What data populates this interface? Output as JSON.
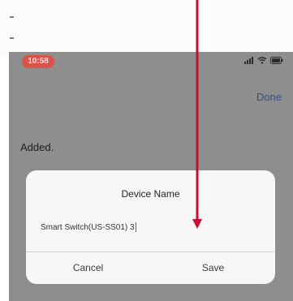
{
  "top_strip": {
    "dash_1": "-",
    "dash_2": "-"
  },
  "status_bar": {
    "time": "10:58",
    "icons": [
      "signal-icon",
      "wifi-icon",
      "battery-icon"
    ]
  },
  "header": {
    "done_label": "Done"
  },
  "content": {
    "added_label": "Added."
  },
  "dialog": {
    "title": "Device Name",
    "input_value": "Smart Switch(US-SS01) 3",
    "cancel_label": "Cancel",
    "save_label": "Save"
  },
  "colors": {
    "annotation_arrow": "#c8102e",
    "time_pill": "#d9534a",
    "done_link": "#3a4f8a"
  }
}
